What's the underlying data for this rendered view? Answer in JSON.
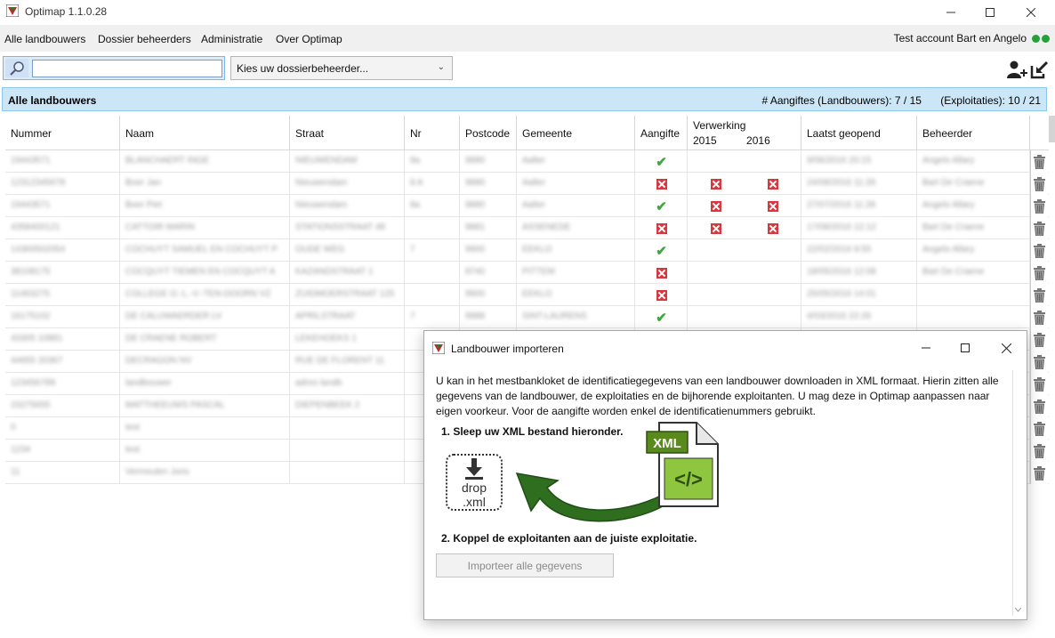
{
  "window": {
    "title": "Optimap 1.1.0.28"
  },
  "menu": {
    "items": [
      "Alle landbouwers",
      "Dossier beheerders",
      "Administratie",
      "Over Optimap"
    ],
    "account": "Test account Bart en Angelo",
    "status_color": "#27a03c"
  },
  "toolbar": {
    "search_value": "",
    "select_value": "Kies uw dossierbeheerder...",
    "icons": [
      "add-user-icon",
      "export-icon"
    ]
  },
  "strip": {
    "title": "Alle landbouwers",
    "aangiftes": "# Aangiftes (Landbouwers): 7 / 15",
    "exploitaties": "(Exploitaties): 10 / 21"
  },
  "grid": {
    "columns": [
      "Nummer",
      "Naam",
      "Straat",
      "Nr",
      "Postcode",
      "Gemeente",
      "Aangifte",
      "Verwerking",
      "2015",
      "2016",
      "Laatst geopend",
      "Beheerder"
    ],
    "rows": [
      {
        "nummer": "19443571",
        "naam": "BLANCHAERT INGE",
        "straat": "NIEUWENDAM",
        "nr": "8a",
        "postcode": "9880",
        "gemeente": "Aalter",
        "aangifte": "check",
        "v2015": "",
        "v2016": "",
        "laatst": "9/06/2016 20:15",
        "beheerder": "Angelo Allary"
      },
      {
        "nummer": "12312345678",
        "naam": "Boer Jan",
        "straat": "Nieuwendam",
        "nr": "8 A",
        "postcode": "9880",
        "gemeente": "Aalter",
        "aangifte": "cross",
        "v2015": "cross",
        "v2016": "cross",
        "laatst": "24/08/2016 11:28",
        "beheerder": "Bart De Craene"
      },
      {
        "nummer": "19443571",
        "naam": "Boer Piet",
        "straat": "Nieuwendam",
        "nr": "8a",
        "postcode": "9880",
        "gemeente": "Aalter",
        "aangifte": "check",
        "v2015": "cross",
        "v2016": "cross",
        "laatst": "27/07/2016 11:28",
        "beheerder": "Angelo Allary"
      },
      {
        "nummer": "4358400121",
        "naam": "CATTOIR MARIN",
        "straat": "STATIONSSTRAAT 48",
        "nr": "",
        "postcode": "9881",
        "gemeente": "ASSENEDE",
        "aangifte": "cross",
        "v2015": "cross",
        "v2016": "cross",
        "laatst": "17/08/2016 12:12",
        "beheerder": "Bart De Craene"
      },
      {
        "nummer": "14300502054",
        "naam": "COCHUYT SAMUEL EN COCHUYT P",
        "straat": "OUDE WEG",
        "nr": "7",
        "postcode": "9900",
        "gemeente": "EEKLO",
        "aangifte": "check",
        "v2015": "",
        "v2016": "",
        "laatst": "22/02/2016 9:55",
        "beheerder": "Angelo Allary"
      },
      {
        "nummer": "38108175",
        "naam": "COCQUYT TIEMEN EN COCQUYT A",
        "straat": "KAZANDSTRAAT 1",
        "nr": "",
        "postcode": "8740",
        "gemeente": "PITTEM",
        "aangifte": "cross",
        "v2015": "",
        "v2016": "",
        "laatst": "18/05/2016 12:08",
        "beheerder": "Bart De Craene"
      },
      {
        "nummer": "11463275",
        "naam": "COLLEGE O.-L.-V.-TEN-DOORN VZ",
        "straat": "ZUIDMOERSTRAAT 125",
        "nr": "",
        "postcode": "9900",
        "gemeente": "EEKLO",
        "aangifte": "cross",
        "v2015": "",
        "v2016": "",
        "laatst": "25/05/2016 14:01",
        "beheerder": ""
      },
      {
        "nummer": "16175102",
        "naam": "DE CALUWAERDER LV",
        "straat": "APRILSTRAAT",
        "nr": "7",
        "postcode": "9988",
        "gemeente": "SINT-LAURENS",
        "aangifte": "check",
        "v2015": "",
        "v2016": "",
        "laatst": "4/03/2016 22:26",
        "beheerder": ""
      },
      {
        "nummer": "43305 10881",
        "naam": "DE CRAENE ROBERT",
        "straat": "LEKEHOEKS 1",
        "nr": "",
        "postcode": "",
        "gemeente": "",
        "aangifte": "",
        "v2015": "",
        "v2016": "",
        "laatst": "",
        "beheerder": ""
      },
      {
        "nummer": "44655 20367",
        "naam": "DECRAGON NV",
        "straat": "RUE DE FLORENT 11",
        "nr": "",
        "postcode": "",
        "gemeente": "",
        "aangifte": "",
        "v2015": "",
        "v2016": "",
        "laatst": "",
        "beheerder": ""
      },
      {
        "nummer": "123456789",
        "naam": "landbouwer",
        "straat": "adres landb",
        "nr": "",
        "postcode": "",
        "gemeente": "",
        "aangifte": "",
        "v2015": "",
        "v2016": "",
        "laatst": "",
        "beheerder": ""
      },
      {
        "nummer": "23275655",
        "naam": "MATTHEEUWS PASCAL",
        "straat": "DIEPENBEEK 2",
        "nr": "",
        "postcode": "",
        "gemeente": "",
        "aangifte": "",
        "v2015": "",
        "v2016": "",
        "laatst": "",
        "beheerder": ""
      },
      {
        "nummer": "0",
        "naam": "test",
        "straat": "",
        "nr": "",
        "postcode": "",
        "gemeente": "",
        "aangifte": "",
        "v2015": "",
        "v2016": "",
        "laatst": "",
        "beheerder": ""
      },
      {
        "nummer": "1234",
        "naam": "test",
        "straat": "",
        "nr": "",
        "postcode": "",
        "gemeente": "",
        "aangifte": "",
        "v2015": "",
        "v2016": "",
        "laatst": "",
        "beheerder": ""
      },
      {
        "nummer": "11",
        "naam": "Vermeulen Joris",
        "straat": "",
        "nr": "",
        "postcode": "",
        "gemeente": "",
        "aangifte": "",
        "v2015": "",
        "v2016": "",
        "laatst": "",
        "beheerder": ""
      }
    ]
  },
  "dialog": {
    "title": "Landbouwer importeren",
    "description": "U kan in het mestbankloket de identificatiegegevens van een landbouwer downloaden in XML formaat. Hierin zitten alle gegevens van de landbouwer, de exploitaties en de bijhorende exploitanten. U mag deze in Optimap aanpassen naar eigen voorkeur. Voor de aangifte worden enkel de identificatienummers gebruikt.",
    "step1": "1. Sleep uw XML bestand hieronder.",
    "drop_line1": "drop",
    "drop_line2": ".xml",
    "xml_badge": "XML",
    "xml_code": "</>",
    "step2": "2. Koppel de exploitanten aan de juiste exploitatie.",
    "import_button": "Importeer alle gegevens",
    "arrow_color": "#2e6e1e"
  }
}
